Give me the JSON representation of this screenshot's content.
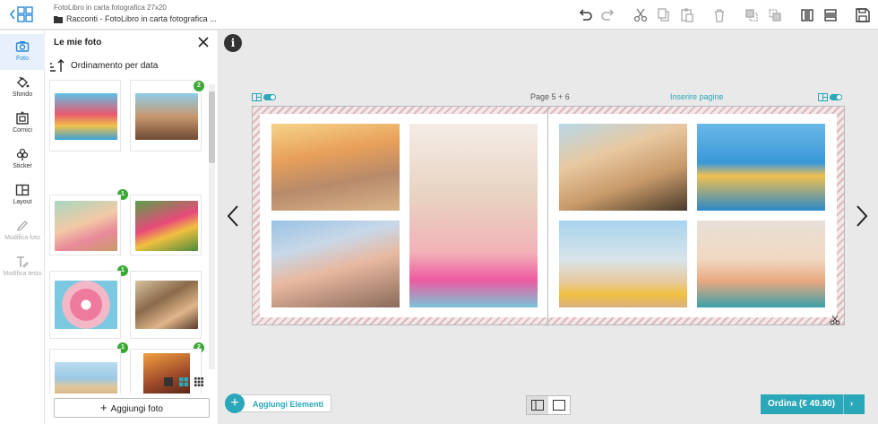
{
  "header": {
    "doc_title": "FotoLibro in carta fotografica 27x20",
    "doc_subtitle": "Racconti - FotoLibro in carta fotografica ..."
  },
  "rail": {
    "items": [
      {
        "label": "Foto",
        "icon": "camera-icon",
        "active": true
      },
      {
        "label": "Sfondo",
        "icon": "paint-bucket-icon"
      },
      {
        "label": "Cornici",
        "icon": "frame-icon"
      },
      {
        "label": "Sticker",
        "icon": "sticker-icon"
      },
      {
        "label": "Layout",
        "icon": "layout-icon"
      },
      {
        "label": "Modifica foto",
        "icon": "pencil-icon",
        "disabled": true
      },
      {
        "label": "Modifica testo",
        "icon": "text-icon",
        "disabled": true
      }
    ]
  },
  "panel": {
    "title": "Le mie foto",
    "sort_label": "Ordinamento per data",
    "add_photo_label": "Aggiungi foto",
    "badges": [
      "2",
      "1",
      "1",
      "1",
      "2"
    ]
  },
  "canvas": {
    "page_label": "Page 5 + 6",
    "insert_pages_label": "Inserire pagine"
  },
  "bottom": {
    "add_elements_label": "Aggiungi Elementi",
    "order_label": "Ordina (€ 49.90)",
    "order_chevron": "›"
  },
  "colors": {
    "accent": "#2aa7b8",
    "active_rail": "#2a8ad8",
    "badge": "#3aa935"
  }
}
